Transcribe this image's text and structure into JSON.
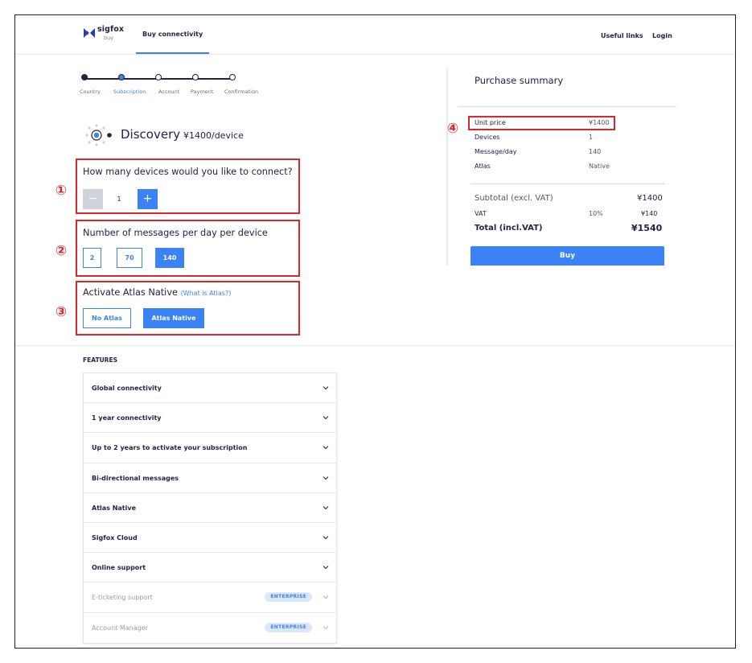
{
  "header": {
    "brand_name": "sigfox",
    "brand_sub": "buy",
    "nav_buy": "Buy connectivity",
    "useful_links": "Useful links",
    "login": "Login"
  },
  "stepper": {
    "steps": [
      {
        "label": "Country",
        "state": "done"
      },
      {
        "label": "Subscription",
        "state": "current"
      },
      {
        "label": "Account",
        "state": "todo"
      },
      {
        "label": "Payment",
        "state": "todo"
      },
      {
        "label": "Confirmation",
        "state": "todo"
      }
    ]
  },
  "plan": {
    "name": "Discovery",
    "price": "¥1400/device"
  },
  "annotations": [
    "①",
    "②",
    "③",
    "④"
  ],
  "devices": {
    "title": "How many devices would you like to connect?",
    "minus": "−",
    "value": "1",
    "plus": "+"
  },
  "messages": {
    "title": "Number of messages per day per device",
    "options": [
      "2",
      "70",
      "140"
    ],
    "selected": "140"
  },
  "atlas": {
    "title": "Activate Atlas Native",
    "link": "(What is Atlas?)",
    "options": [
      "No Atlas",
      "Atlas Native"
    ],
    "selected": "Atlas Native"
  },
  "summary": {
    "title": "Purchase summary",
    "rows": [
      {
        "label": "Unit price",
        "value": "¥1400"
      },
      {
        "label": "Devices",
        "value": "1"
      },
      {
        "label": "Message/day",
        "value": "140"
      },
      {
        "label": "Atlas",
        "value": "Native"
      }
    ],
    "subtotal_label": "Subtotal (excl. VAT)",
    "subtotal_value": "¥1400",
    "vat_label": "VAT",
    "vat_rate": "10%",
    "vat_value": "¥140",
    "total_label": "Total (incl.VAT)",
    "total_value": "¥1540",
    "buy_label": "Buy"
  },
  "features": {
    "title": "FEATURES",
    "items": [
      {
        "label": "Global connectivity",
        "badge": ""
      },
      {
        "label": "1 year connectivity",
        "badge": ""
      },
      {
        "label": "Up to 2 years to activate your subscription",
        "badge": ""
      },
      {
        "label": "Bi-directional messages",
        "badge": ""
      },
      {
        "label": "Atlas Native",
        "badge": ""
      },
      {
        "label": "Sigfox Cloud",
        "badge": ""
      },
      {
        "label": "Online support",
        "badge": ""
      },
      {
        "label": "E-ticketing support",
        "badge": "ENTERPRISE"
      },
      {
        "label": "Account Manager",
        "badge": "ENTERPRISE"
      }
    ]
  },
  "colors": {
    "accent": "#3b82f6",
    "annotation_red": "#e0242b",
    "navy": "#22224a"
  }
}
